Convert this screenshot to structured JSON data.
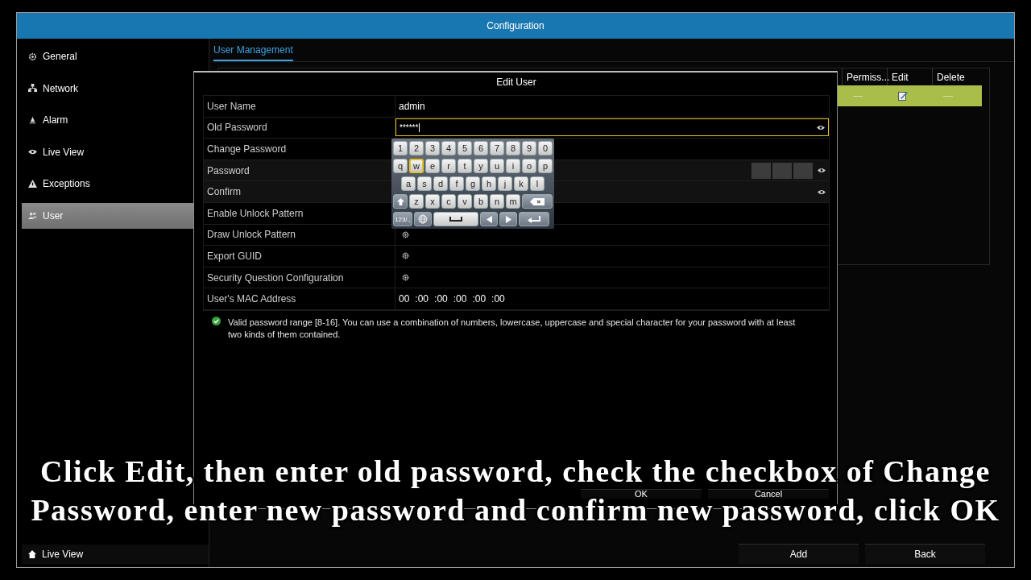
{
  "window": {
    "title": "Configuration"
  },
  "sidebar": {
    "items": [
      {
        "label": "General",
        "kind": "gear",
        "selected": false
      },
      {
        "label": "Network",
        "kind": "network",
        "selected": false
      },
      {
        "label": "Alarm",
        "kind": "alarm",
        "selected": false
      },
      {
        "label": "Live View",
        "kind": "eye",
        "selected": false
      },
      {
        "label": "Exceptions",
        "kind": "warning",
        "selected": false
      },
      {
        "label": "User",
        "kind": "users",
        "selected": true
      }
    ],
    "bottom_button": "Live View"
  },
  "tabs": [
    {
      "label": "User Management",
      "selected": true
    }
  ],
  "table": {
    "columns": [
      "Permiss...",
      "Edit",
      "Delete"
    ],
    "rows": [
      {
        "selected": true,
        "cells": [
          {
            "kind": "text",
            "text": "—"
          },
          {
            "kind": "edit"
          },
          {
            "kind": "text",
            "text": "—"
          }
        ]
      }
    ]
  },
  "buttons": [
    "Add",
    "Back"
  ],
  "dialog": {
    "title": "Edit User",
    "rows": [
      {
        "kind": "text",
        "label": "User Name",
        "value": "admin"
      },
      {
        "kind": "input",
        "label": "Old Password",
        "value": "******",
        "focused": true
      },
      {
        "kind": "plain",
        "label": "Change Password"
      },
      {
        "kind": "strength",
        "label": "Password"
      },
      {
        "kind": "secret",
        "label": "Confirm"
      },
      {
        "kind": "plain",
        "label": "Enable Unlock Pattern"
      },
      {
        "kind": "gear",
        "label": "Draw Unlock Pattern"
      },
      {
        "kind": "gear",
        "label": "Export GUID"
      },
      {
        "kind": "gear",
        "label": "Security Question Configuration"
      },
      {
        "kind": "mac",
        "label": "User's MAC Address",
        "parts": [
          "00",
          ":00",
          ":00",
          ":00",
          ":00",
          ":00"
        ]
      }
    ],
    "note": "Valid password range [8-16]. You can use a combination of numbers, lowercase, uppercase and special character for your password with at least two kinds of them contained.",
    "buttons": [
      "OK",
      "Cancel"
    ],
    "keyboard": {
      "rows": [
        {
          "keys": [
            {
              "kind": "char",
              "label": "1",
              "selected": false
            },
            {
              "kind": "char",
              "label": "2",
              "selected": false
            },
            {
              "kind": "char",
              "label": "3",
              "selected": false
            },
            {
              "kind": "char",
              "label": "4",
              "selected": false
            },
            {
              "kind": "char",
              "label": "5",
              "selected": false
            },
            {
              "kind": "char",
              "label": "6",
              "selected": false
            },
            {
              "kind": "char",
              "label": "7",
              "selected": false
            },
            {
              "kind": "char",
              "label": "8",
              "selected": false
            },
            {
              "kind": "char",
              "label": "9",
              "selected": false
            },
            {
              "kind": "char",
              "label": "0",
              "selected": false
            }
          ]
        },
        {
          "keys": [
            {
              "kind": "char",
              "label": "q",
              "selected": false
            },
            {
              "kind": "char",
              "label": "w",
              "selected": true
            },
            {
              "kind": "char",
              "label": "e",
              "selected": false
            },
            {
              "kind": "char",
              "label": "r",
              "selected": false
            },
            {
              "kind": "char",
              "label": "t",
              "selected": false
            },
            {
              "kind": "char",
              "label": "y",
              "selected": false
            },
            {
              "kind": "char",
              "label": "u",
              "selected": false
            },
            {
              "kind": "char",
              "label": "i",
              "selected": false
            },
            {
              "kind": "char",
              "label": "o",
              "selected": false
            },
            {
              "kind": "char",
              "label": "p",
              "selected": false
            }
          ]
        },
        {
          "keys": [
            {
              "kind": "char",
              "label": "a",
              "selected": false
            },
            {
              "kind": "char",
              "label": "s",
              "selected": false
            },
            {
              "kind": "char",
              "label": "d",
              "selected": false
            },
            {
              "kind": "char",
              "label": "f",
              "selected": false
            },
            {
              "kind": "char",
              "label": "g",
              "selected": false
            },
            {
              "kind": "char",
              "label": "h",
              "selected": false
            },
            {
              "kind": "char",
              "label": "j",
              "selected": false
            },
            {
              "kind": "char",
              "label": "k",
              "selected": false
            },
            {
              "kind": "char",
              "label": "l",
              "selected": false
            }
          ]
        },
        {
          "keys": [
            {
              "kind": "shift",
              "selected": false
            },
            {
              "kind": "char",
              "label": "z",
              "selected": false
            },
            {
              "kind": "char",
              "label": "x",
              "selected": false
            },
            {
              "kind": "char",
              "label": "c",
              "selected": false
            },
            {
              "kind": "char",
              "label": "v",
              "selected": false
            },
            {
              "kind": "char",
              "label": "b",
              "selected": false
            },
            {
              "kind": "char",
              "label": "n",
              "selected": false
            },
            {
              "kind": "char",
              "label": "m",
              "selected": false
            },
            {
              "kind": "backspace",
              "selected": false
            }
          ]
        },
        {
          "keys": [
            {
              "kind": "mode",
              "label": "123/.,",
              "selected": false
            },
            {
              "kind": "globe",
              "selected": false
            },
            {
              "kind": "space",
              "selected": false
            },
            {
              "kind": "left",
              "selected": false
            },
            {
              "kind": "right",
              "selected": false
            },
            {
              "kind": "enter",
              "selected": false
            }
          ]
        }
      ]
    }
  },
  "caption": [
    "Click Edit, then enter old password, check the checkbox of Change",
    "Password, enter new password and confirm new password, click OK"
  ]
}
